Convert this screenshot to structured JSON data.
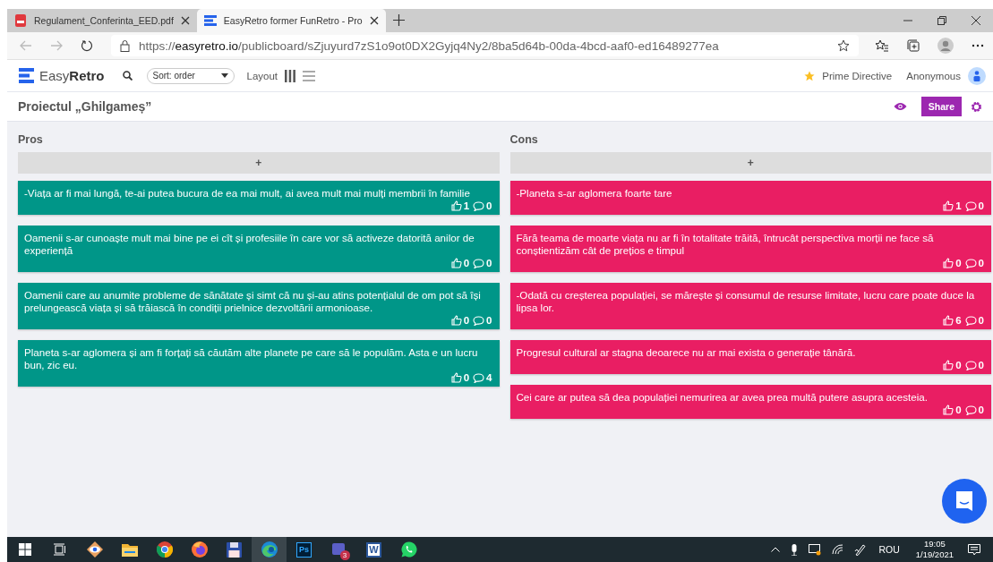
{
  "browser": {
    "tabs": [
      {
        "title": "Regulament_Conferinta_EED.pdf",
        "kind": "pdf",
        "selected": false
      },
      {
        "title": "EasyRetro former FunRetro - Pro",
        "kind": "retro",
        "selected": true
      }
    ],
    "url_prefix": "https://",
    "url_host": "easyretro.io",
    "url_path": "/publicboard/sZjuyurd7zS1o9ot0DX2Gyjq4Ny2/8ba5d64b-00da-4bcd-aaf0-ed16489277ea"
  },
  "app": {
    "logo_light": "Easy",
    "logo_bold": "Retro",
    "sort": "Sort: order",
    "layout_label": "Layout",
    "prime_directive": "Prime Directive",
    "user": "Anonymous"
  },
  "board": {
    "title": "Proiectul „Ghilgameș”",
    "share": "Share"
  },
  "columns": [
    {
      "title": "Pros",
      "color": "#009688",
      "add": "+",
      "cards": [
        {
          "text": "-Viața ar fi mai lungă, te-ai putea bucura de ea mai mult, ai avea mult mai mulți membrii în familie",
          "likes": "1",
          "comments": "0"
        },
        {
          "text": "Oamenii s-ar cunoaște mult mai bine pe ei cît și profesiile în care vor să activeze datorită anilor de experiență",
          "likes": "0",
          "comments": "0"
        },
        {
          "text": "Oamenii care au anumite probleme de sănătate și simt că nu și-au atins potențialul de om pot să își prelungească viața și să trăiască în condiții prielnice dezvoltării armonioase.",
          "likes": "0",
          "comments": "0"
        },
        {
          "text": "Planeta s-ar aglomera și am fi forțați să căutăm alte planete pe care să le populăm. Asta e un lucru bun, zic eu.",
          "likes": "0",
          "comments": "4"
        }
      ]
    },
    {
      "title": "Cons",
      "color": "#e91e63",
      "add": "+",
      "cards": [
        {
          "text": "-Planeta s-ar aglomera foarte tare",
          "likes": "1",
          "comments": "0"
        },
        {
          "text": "Fără teama de moarte viața nu ar fi în totalitate trăită, întrucât perspectiva morții ne face să conștientizăm cât de prețios e timpul",
          "likes": "0",
          "comments": "0"
        },
        {
          "text": "-Odată cu creșterea populației, se mărește și consumul de resurse limitate, lucru care poate duce la lipsa lor.",
          "likes": "6",
          "comments": "0"
        },
        {
          "text": "Progresul cultural ar stagna deoarece nu ar mai exista o generație tânără.",
          "likes": "0",
          "comments": "0"
        },
        {
          "text": "Cei care ar putea să dea populației nemurirea ar avea prea multă putere asupra acesteia.",
          "likes": "0",
          "comments": "0"
        }
      ]
    }
  ],
  "taskbar": {
    "apps": [
      {
        "kind": "start",
        "selected": false
      },
      {
        "kind": "taskview",
        "selected": false
      },
      {
        "kind": "viewer",
        "selected": false
      },
      {
        "kind": "explorer",
        "selected": false
      },
      {
        "kind": "chrome",
        "selected": false
      },
      {
        "kind": "firefox",
        "selected": false
      },
      {
        "kind": "disk",
        "selected": false
      },
      {
        "kind": "edge",
        "selected": true
      },
      {
        "kind": "ps",
        "label": "Ps",
        "selected": false
      },
      {
        "kind": "teams",
        "badge": "3",
        "selected": false
      },
      {
        "kind": "word",
        "label": "W",
        "selected": false
      },
      {
        "kind": "whatsapp",
        "selected": false
      }
    ],
    "language": "ROU",
    "time": "19:05",
    "date": "1/19/2021"
  }
}
